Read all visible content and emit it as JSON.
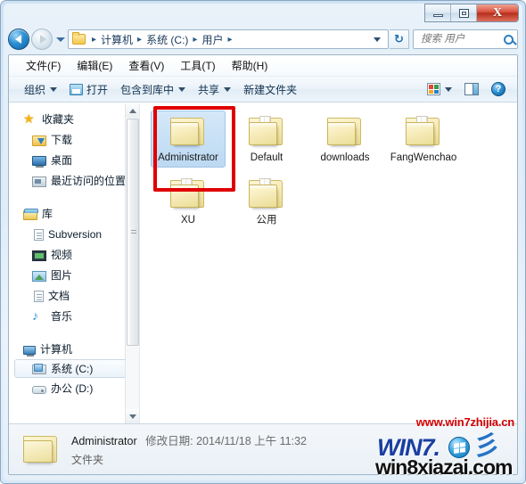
{
  "window": {
    "controls": {
      "minimize": "—",
      "maximize": "❐",
      "close": "X"
    }
  },
  "addressbar": {
    "back_tooltip": "后退",
    "forward_tooltip": "前进",
    "crumbs": [
      "计算机",
      "系统 (C:)",
      "用户"
    ],
    "separator": "▸",
    "refresh_glyph": "↻"
  },
  "search": {
    "placeholder": "搜索 用户",
    "value": ""
  },
  "menubar": {
    "items": [
      {
        "label": "文件(F)"
      },
      {
        "label": "编辑(E)"
      },
      {
        "label": "查看(V)"
      },
      {
        "label": "工具(T)"
      },
      {
        "label": "帮助(H)"
      }
    ]
  },
  "toolbar": {
    "organize": "组织",
    "open": "打开",
    "include_in_library": "包含到库中",
    "share": "共享",
    "new_folder": "新建文件夹",
    "help_glyph": "?"
  },
  "sidebar": {
    "groups": [
      {
        "header": {
          "label": "收藏夹",
          "icon": "star-icon"
        },
        "items": [
          {
            "label": "下载",
            "icon": "download-folder-icon"
          },
          {
            "label": "桌面",
            "icon": "desktop-icon"
          },
          {
            "label": "最近访问的位置",
            "icon": "recent-places-icon"
          }
        ]
      },
      {
        "header": {
          "label": "库",
          "icon": "library-icon"
        },
        "items": [
          {
            "label": "Subversion",
            "icon": "document-icon"
          },
          {
            "label": "视频",
            "icon": "video-icon"
          },
          {
            "label": "图片",
            "icon": "picture-icon"
          },
          {
            "label": "音乐",
            "icon": "music-icon"
          }
        ]
      },
      {
        "header": {
          "label": "计算机",
          "icon": "computer-icon"
        },
        "items": [
          {
            "label": "系统 (C:)",
            "icon": "system-drive-icon",
            "selected": true
          },
          {
            "label": "办公 (D:)",
            "icon": "drive-icon",
            "selected": false
          }
        ]
      }
    ]
  },
  "content": {
    "files": [
      {
        "name": "Administrator",
        "type": "folder",
        "selected": true,
        "annotated": true
      },
      {
        "name": "Default",
        "type": "folder",
        "selected": false,
        "annotated": false
      },
      {
        "name": "downloads",
        "type": "folder",
        "selected": false,
        "annotated": false
      },
      {
        "name": "FangWenchao",
        "type": "folder",
        "selected": false,
        "annotated": false
      },
      {
        "name": "XU",
        "type": "folder",
        "selected": false,
        "annotated": false
      },
      {
        "name": "公用",
        "type": "folder",
        "selected": false,
        "annotated": false
      }
    ]
  },
  "statusbar": {
    "name": "Administrator",
    "modified_label": "修改日期: 2014/11/18 上午 11:32",
    "type": "文件夹"
  },
  "watermarks": {
    "url_top": "www.win7zhijia.cn",
    "logo_text": "WIN7.",
    "url_bottom": "win8xiazai.com"
  },
  "colors": {
    "annotation_red": "#e00000",
    "selection_blue": "#bcd9f2",
    "watermark_red": "#d40000",
    "logo_blue": "#1a3fa0"
  }
}
